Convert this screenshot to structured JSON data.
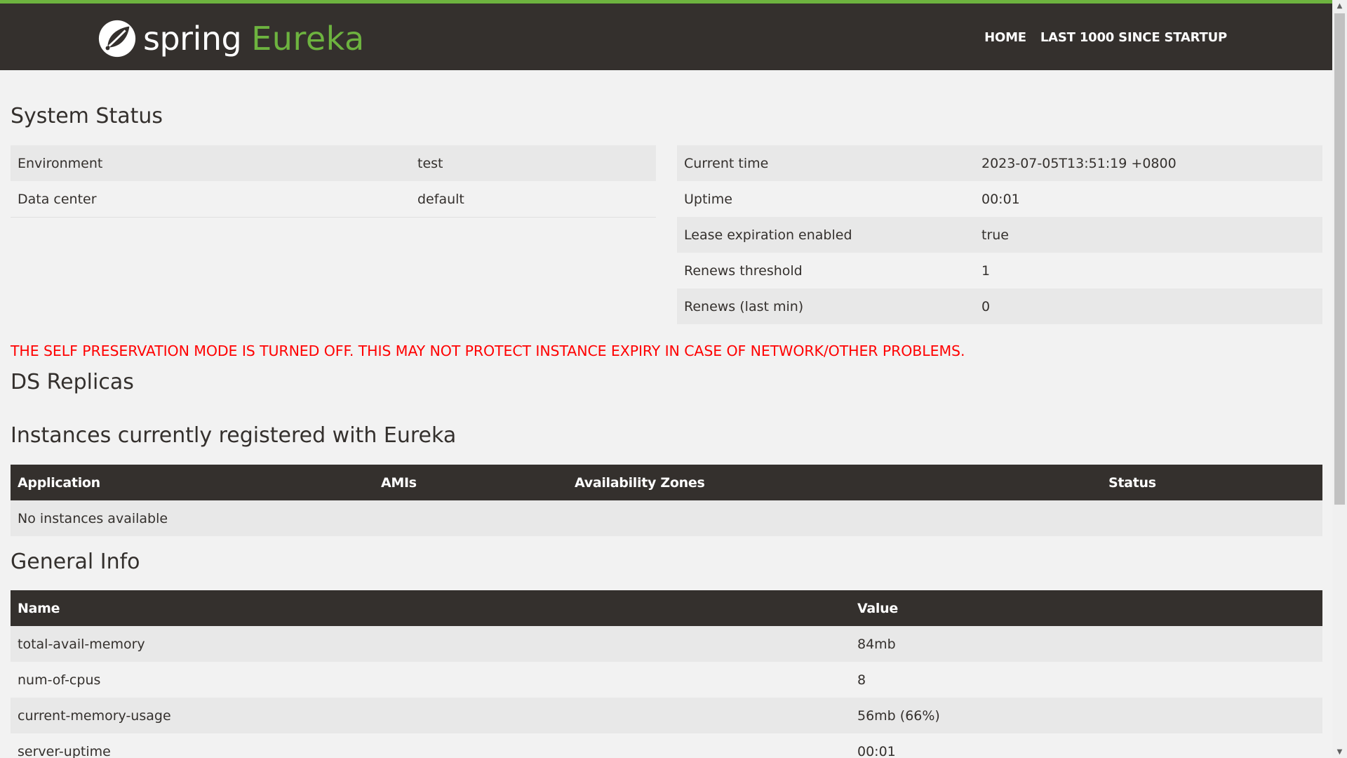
{
  "header": {
    "brand_spring": "spring",
    "brand_eureka": "Eureka",
    "nav": [
      "HOME",
      "LAST 1000 SINCE STARTUP"
    ],
    "logo_icon": "spring-leaf-logo-icon"
  },
  "colors": {
    "header_bg": "#34302d",
    "accent": "#6db33f",
    "warning": "#ff0000"
  },
  "system_status": {
    "title": "System Status",
    "left": [
      {
        "key": "Environment",
        "value": "test"
      },
      {
        "key": "Data center",
        "value": "default"
      }
    ],
    "right": [
      {
        "key": "Current time",
        "value": "2023-07-05T13:51:19 +0800"
      },
      {
        "key": "Uptime",
        "value": "00:01"
      },
      {
        "key": "Lease expiration enabled",
        "value": "true"
      },
      {
        "key": "Renews threshold",
        "value": "1"
      },
      {
        "key": "Renews (last min)",
        "value": "0"
      }
    ]
  },
  "warning": "THE SELF PRESERVATION MODE IS TURNED OFF. THIS MAY NOT PROTECT INSTANCE EXPIRY IN CASE OF NETWORK/OTHER PROBLEMS.",
  "ds_replicas": {
    "title": "DS Replicas"
  },
  "instances": {
    "title": "Instances currently registered with Eureka",
    "columns": [
      "Application",
      "AMIs",
      "Availability Zones",
      "Status"
    ],
    "empty_text": "No instances available"
  },
  "general_info": {
    "title": "General Info",
    "columns": [
      "Name",
      "Value"
    ],
    "rows": [
      {
        "name": "total-avail-memory",
        "value": "84mb"
      },
      {
        "name": "num-of-cpus",
        "value": "8"
      },
      {
        "name": "current-memory-usage",
        "value": "56mb (66%)"
      },
      {
        "name": "server-uptime",
        "value": "00:01"
      }
    ]
  }
}
